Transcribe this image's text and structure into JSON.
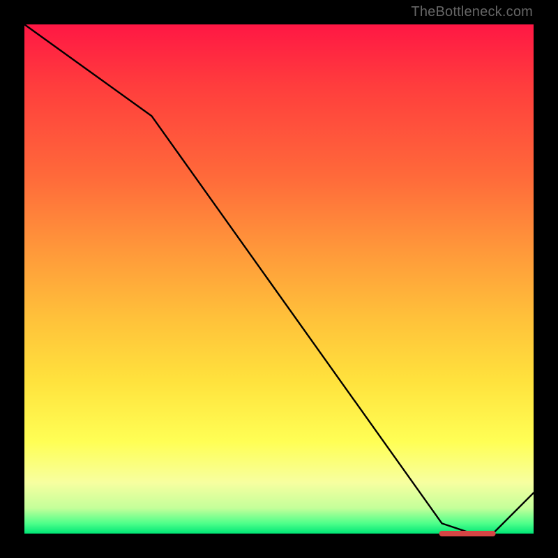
{
  "watermark": "TheBottleneck.com",
  "chart_data": {
    "type": "line",
    "title": "",
    "xlabel": "",
    "ylabel": "",
    "xlim": [
      0,
      100
    ],
    "ylim": [
      0,
      100
    ],
    "x": [
      0,
      25,
      82,
      88,
      92,
      100
    ],
    "values": [
      100,
      82,
      2,
      0,
      0,
      8
    ],
    "marker_segment": {
      "x_start": 82,
      "x_end": 92,
      "y": 0,
      "color": "#d64545"
    },
    "background_gradient": {
      "stops": [
        {
          "pos": 0,
          "color": "#ff1744"
        },
        {
          "pos": 50,
          "color": "#ffb03a"
        },
        {
          "pos": 82,
          "color": "#ffff55"
        },
        {
          "pos": 100,
          "color": "#00e676"
        }
      ]
    }
  }
}
